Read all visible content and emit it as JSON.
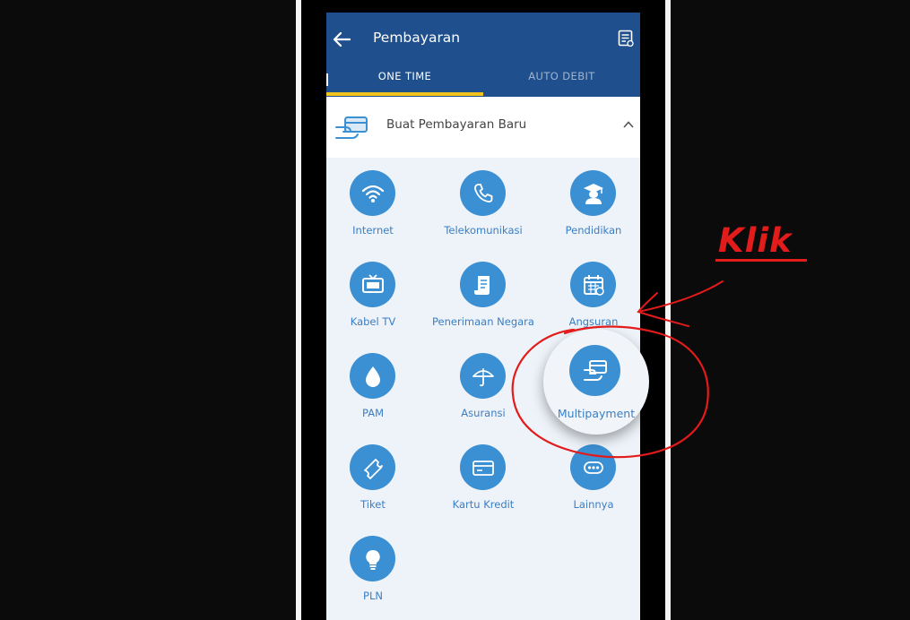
{
  "header": {
    "title": "Pembayaran",
    "back_icon": "arrow-left-icon",
    "action_icon": "receipt-icon"
  },
  "tabs": [
    {
      "label": "ONE TIME",
      "active": true
    },
    {
      "label": "AUTO DEBIT",
      "active": false
    }
  ],
  "section": {
    "label": "Buat Pembayaran Baru",
    "icon": "card-hand-icon",
    "expanded": true
  },
  "categories": [
    {
      "label": "Internet",
      "icon": "wifi-icon"
    },
    {
      "label": "Telekomunikasi",
      "icon": "phone-icon"
    },
    {
      "label": "Pendidikan",
      "icon": "graduate-icon"
    },
    {
      "label": "Kabel TV",
      "icon": "tv-icon"
    },
    {
      "label": "Penerimaan Negara",
      "icon": "scroll-icon"
    },
    {
      "label": "Angsuran",
      "icon": "calendar-icon"
    },
    {
      "label": "PAM",
      "icon": "water-drop-icon"
    },
    {
      "label": "Asuransi",
      "icon": "umbrella-icon"
    },
    {
      "label": "Multipayment",
      "icon": "card-hand-icon",
      "highlighted": true
    },
    {
      "label": "Tiket",
      "icon": "ticket-icon"
    },
    {
      "label": "Kartu Kredit",
      "icon": "credit-card-icon"
    },
    {
      "label": "Lainnya",
      "icon": "more-icon"
    },
    {
      "label": "PLN",
      "icon": "lightbulb-icon"
    }
  ],
  "annotation": {
    "text": "Klik",
    "color": "#e21b1b"
  },
  "colors": {
    "appbar": "#1f4f8c",
    "tab_indicator": "#f2c31c",
    "icon_circle": "#3b8fd3",
    "label": "#3a7ec4"
  }
}
